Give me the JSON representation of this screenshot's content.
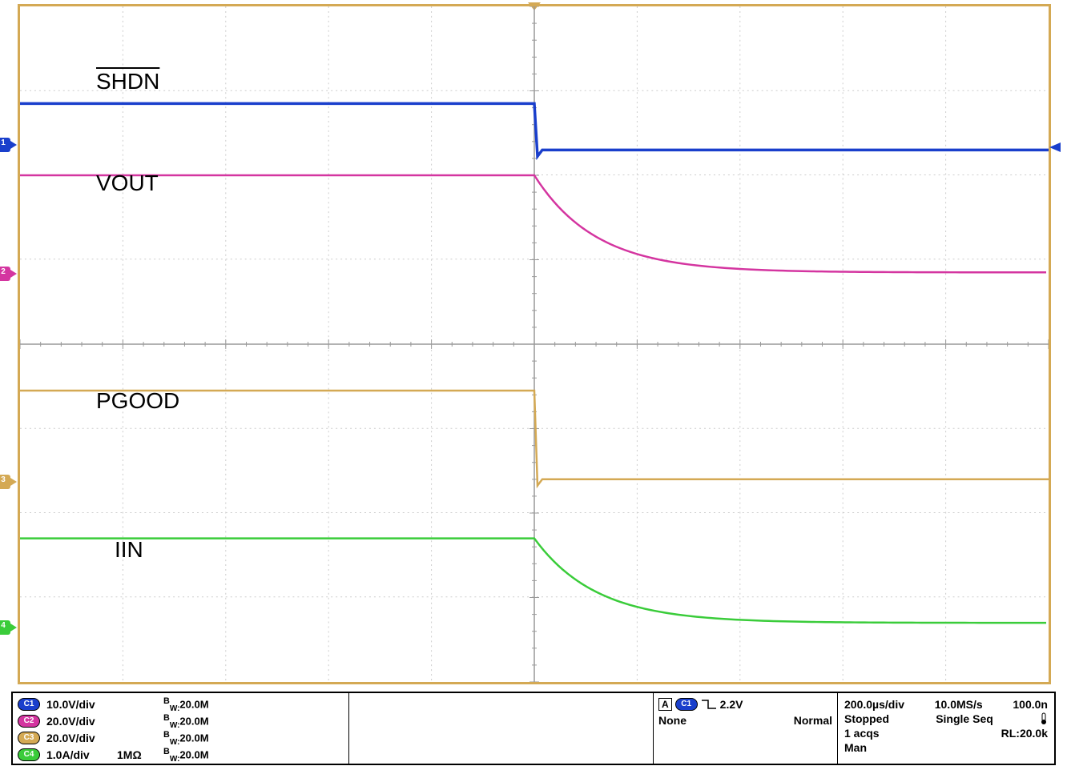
{
  "chart_data": {
    "type": "line",
    "description": "Oscilloscope capture with 4 channels showing shutdown event. Horizontal: 10 divisions at 200µs/div (2ms total). Vertical: 8 divisions. Trigger at center (t=0).",
    "x_divisions": 10,
    "y_divisions": 8,
    "timebase": "200µs/div",
    "trigger_time_div": 5,
    "series": [
      {
        "name": "SHDN",
        "channel": 1,
        "color": "#1a3fcc",
        "scale": "10.0V/div",
        "ref_div_from_top": 1.6,
        "pre_level_div": 1.15,
        "post_level_div": 1.7,
        "shape": "step_down_sharp"
      },
      {
        "name": "VOUT",
        "channel": 2,
        "color": "#d435a0",
        "scale": "20.0V/div",
        "ref_div_from_top": 3.15,
        "pre_level_div": 2.0,
        "post_level_div": 3.15,
        "shape": "step_down_decay"
      },
      {
        "name": "PGOOD",
        "channel": 3,
        "color": "#d4a954",
        "scale": "20.0V/div",
        "ref_div_from_top": 5.6,
        "pre_level_div": 4.55,
        "post_level_div": 5.6,
        "shape": "step_down_sharp"
      },
      {
        "name": "IIN",
        "channel": 4,
        "color": "#3acc3a",
        "scale": "1.0A/div",
        "ref_div_from_top": 7.3,
        "pre_level_div": 6.3,
        "post_level_div": 7.3,
        "shape": "step_down_decay"
      }
    ]
  },
  "labels": {
    "shdn": "SHDN",
    "vout": "VOUT",
    "pgood": "PGOOD",
    "iin": "IIN"
  },
  "channels": {
    "c1": {
      "badge": "C1",
      "scale": "10.0V/div",
      "impedance": "",
      "bw": "20.0M"
    },
    "c2": {
      "badge": "C2",
      "scale": "20.0V/div",
      "impedance": "",
      "bw": "20.0M"
    },
    "c3": {
      "badge": "C3",
      "scale": "20.0V/div",
      "impedance": "",
      "bw": "20.0M"
    },
    "c4": {
      "badge": "C4",
      "scale": "1.0A/div",
      "impedance": "1MΩ",
      "bw": "20.0M"
    }
  },
  "trigger": {
    "a_label": "A",
    "source": "C1",
    "level": "2.2V",
    "coupling": "None",
    "mode": "Normal"
  },
  "timebase": {
    "scale": "200.0µs/div",
    "rate": "10.0MS/s",
    "interval": "100.0n",
    "state": "Stopped",
    "seq": "Single Seq",
    "acqs": "1 acqs",
    "rl": "RL:20.0k",
    "man": "Man"
  },
  "bw_prefix": "B",
  "bw_suffix": "W:"
}
